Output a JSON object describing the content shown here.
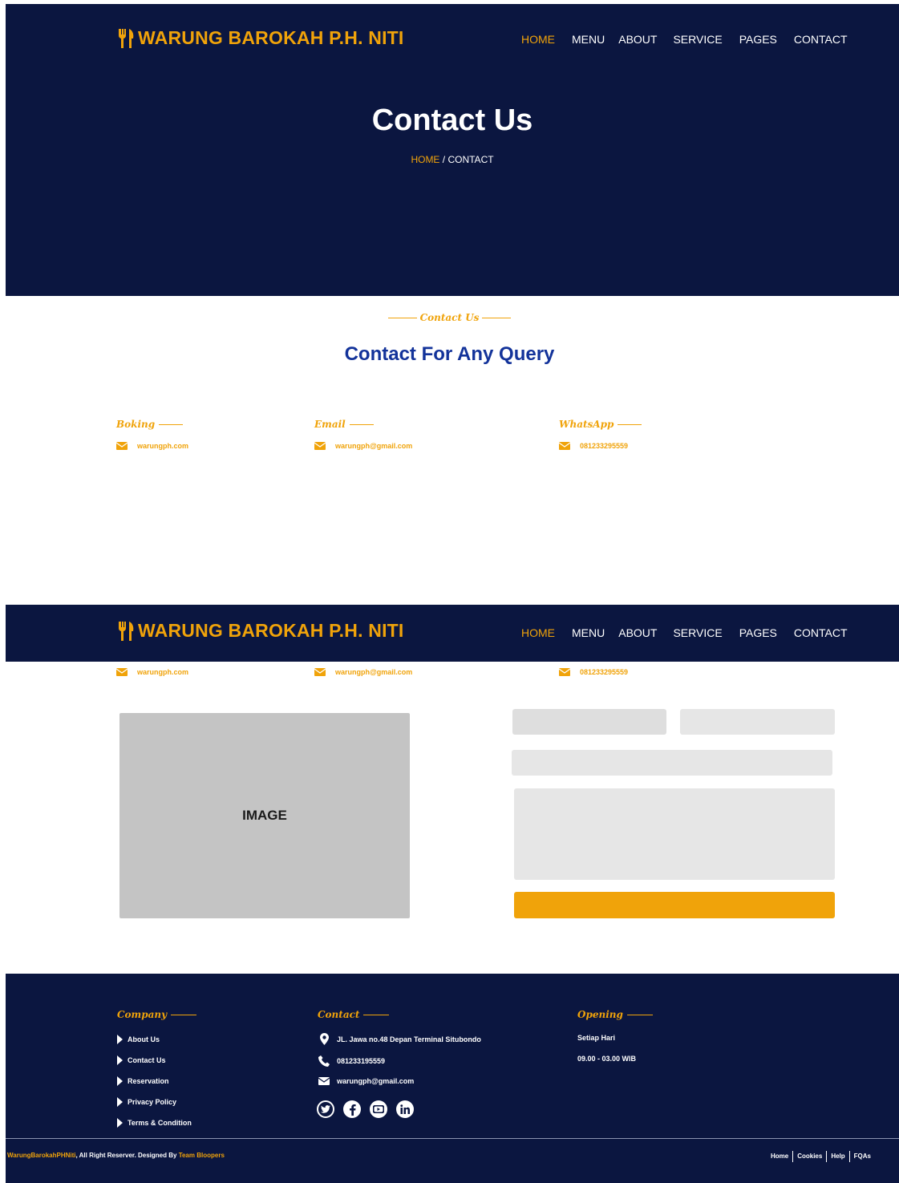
{
  "brand": {
    "name": "WARUNG BAROKAH P.H. NITI"
  },
  "nav": {
    "items": [
      "HOME",
      "MENU",
      "ABOUT",
      "SERVICE",
      "PAGES",
      "CONTACT"
    ],
    "active": "HOME"
  },
  "hero": {
    "title": "Contact Us",
    "breadcrumb_home": "HOME",
    "breadcrumb_sep": " / ",
    "breadcrumb_current": "CONTACT"
  },
  "section": {
    "kicker": "Contact Us",
    "title": "Contact For Any Query"
  },
  "info": [
    {
      "heading": "Boking",
      "value": "warungph.com"
    },
    {
      "heading": "Email",
      "value": "warungph@gmail.com"
    },
    {
      "heading": "WhatsApp",
      "value": "081233295559"
    }
  ],
  "image": {
    "label": "IMAGE"
  },
  "footer": {
    "company": {
      "heading": "Company",
      "links": [
        "About Us",
        "Contact Us",
        "Reservation",
        "Privacy Policy",
        "Terms & Condition"
      ]
    },
    "contact": {
      "heading": "Contact",
      "address": "JL. Jawa no.48 Depan Terminal Situbondo",
      "phone": "081233195559",
      "email": "warungph@gmail.com"
    },
    "opening": {
      "heading": "Opening",
      "days": "Setiap Hari",
      "hours": "09.00 - 03.00 WIB"
    },
    "copyright": {
      "brand": "WarungBarokahPHNiti",
      "middle": ", All Right Reserver. Designed By ",
      "team": "Team Bloopers"
    },
    "bottom_links": [
      "Home",
      "Cookies",
      "Help",
      "FQAs"
    ]
  },
  "colors": {
    "navy": "#0b1640",
    "gold": "#f0a30a",
    "blue": "#13339a",
    "field": "#e6e6e6",
    "image": "#c4c4c4"
  },
  "icons": [
    "utensils-icon",
    "envelope-icon",
    "map-pin-icon",
    "phone-icon",
    "twitter-icon",
    "facebook-icon",
    "youtube-icon",
    "linkedin-icon",
    "caret-right-icon"
  ]
}
